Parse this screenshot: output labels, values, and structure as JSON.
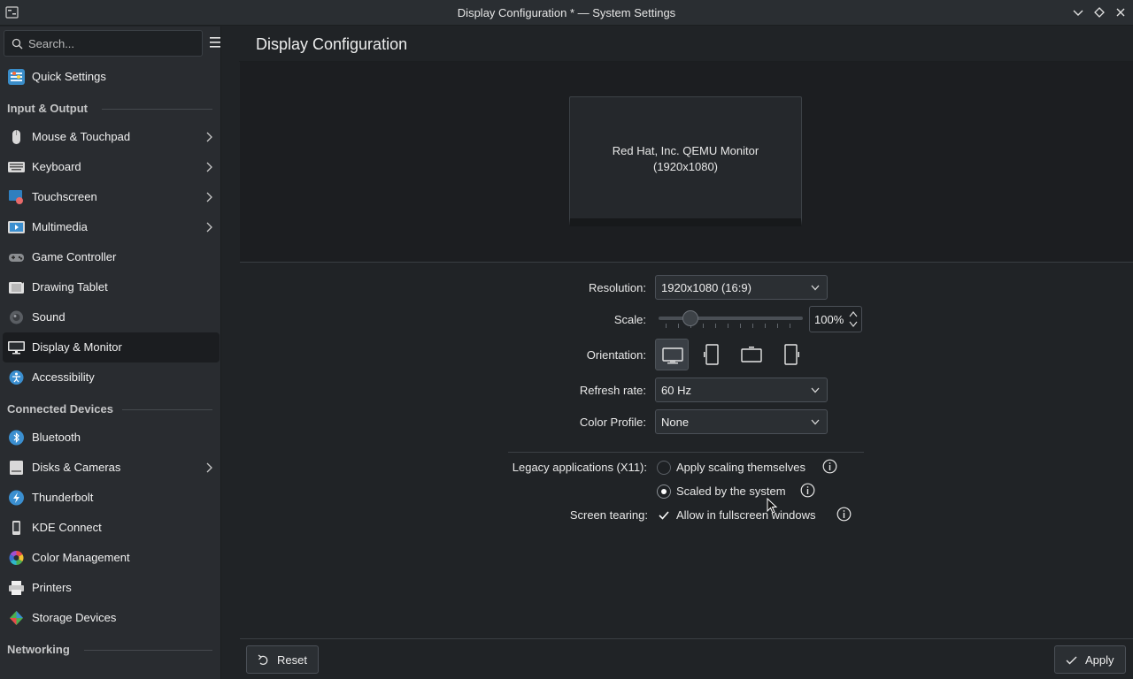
{
  "window": {
    "title": "Display Configuration * — System Settings"
  },
  "sidebar": {
    "search_placeholder": "Search...",
    "top_item": {
      "label": "Quick Settings",
      "icon": "quick-settings-icon"
    },
    "sections": [
      {
        "title": "Input & Output",
        "items": [
          {
            "label": "Mouse & Touchpad",
            "icon": "mouse-icon",
            "has_children": true
          },
          {
            "label": "Keyboard",
            "icon": "keyboard-icon",
            "has_children": true
          },
          {
            "label": "Touchscreen",
            "icon": "touchscreen-icon",
            "has_children": true
          },
          {
            "label": "Multimedia",
            "icon": "multimedia-icon",
            "has_children": true
          },
          {
            "label": "Game Controller",
            "icon": "game-controller-icon",
            "has_children": false
          },
          {
            "label": "Drawing Tablet",
            "icon": "drawing-tablet-icon",
            "has_children": false
          },
          {
            "label": "Sound",
            "icon": "sound-icon",
            "has_children": false
          },
          {
            "label": "Display & Monitor",
            "icon": "display-monitor-icon",
            "has_children": false,
            "active": true
          },
          {
            "label": "Accessibility",
            "icon": "accessibility-icon",
            "has_children": false
          }
        ]
      },
      {
        "title": "Connected Devices",
        "items": [
          {
            "label": "Bluetooth",
            "icon": "bluetooth-icon",
            "has_children": false
          },
          {
            "label": "Disks & Cameras",
            "icon": "disks-cameras-icon",
            "has_children": true
          },
          {
            "label": "Thunderbolt",
            "icon": "thunderbolt-icon",
            "has_children": false
          },
          {
            "label": "KDE Connect",
            "icon": "kde-connect-icon",
            "has_children": false
          },
          {
            "label": "Color Management",
            "icon": "color-management-icon",
            "has_children": false
          },
          {
            "label": "Printers",
            "icon": "printers-icon",
            "has_children": false
          },
          {
            "label": "Storage Devices",
            "icon": "storage-devices-icon",
            "has_children": false
          }
        ]
      },
      {
        "title": "Networking",
        "items": []
      }
    ]
  },
  "header": {
    "title": "Display Configuration"
  },
  "preview": {
    "monitor_name": "Red Hat, Inc. QEMU Monitor",
    "monitor_resolution": "(1920x1080)"
  },
  "settings": {
    "resolution_label": "Resolution:",
    "resolution_value": "1920x1080 (16:9)",
    "scale_label": "Scale:",
    "scale_value": "100%",
    "scale_level_fraction": 0.22,
    "orientation_label": "Orientation:",
    "orientation_selected": "landscape",
    "refresh_label": "Refresh rate:",
    "refresh_value": "60 Hz",
    "color_profile_label": "Color Profile:",
    "color_profile_value": "None",
    "legacy_label": "Legacy applications (X11):",
    "legacy_option_1": "Apply scaling themselves",
    "legacy_option_2": "Scaled by the system",
    "legacy_selected": "Scaled by the system",
    "tearing_label": "Screen tearing:",
    "tearing_option": "Allow in fullscreen windows",
    "tearing_checked": true
  },
  "footer": {
    "reset_label": "Reset",
    "apply_label": "Apply"
  },
  "colors": {
    "background": "#202326",
    "sidebar": "#292c30",
    "active_item": "#1b1d20",
    "text": "#fcfcfc"
  }
}
